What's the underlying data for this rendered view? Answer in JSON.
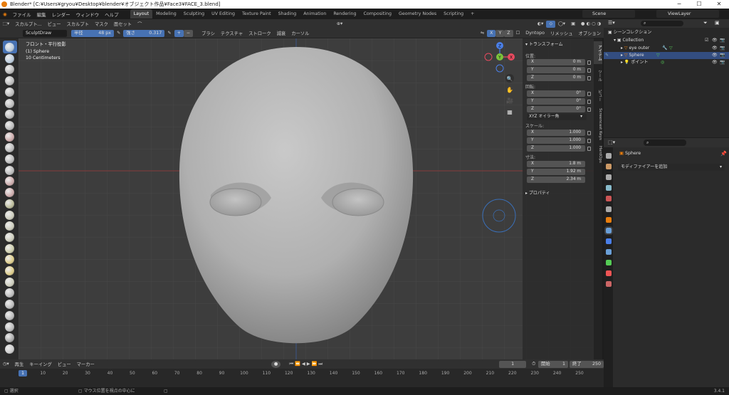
{
  "window": {
    "title": "Blender* [C:¥Users¥gryou¥Desktop¥blender¥オブジェクト作品¥Face3¥FACE_3.blend]",
    "controls": [
      "─",
      "☐",
      "✕"
    ]
  },
  "menus": [
    "ファイル",
    "編集",
    "レンダー",
    "ウィンドウ",
    "ヘルプ"
  ],
  "workspaces": [
    "Layout",
    "Modeling",
    "Sculpting",
    "UV Editing",
    "Texture Paint",
    "Shading",
    "Animation",
    "Rendering",
    "Compositing",
    "Geometry Nodes",
    "Scripting"
  ],
  "active_workspace": "Layout",
  "scene": {
    "name": "Scene",
    "view_layer": "ViewLayer"
  },
  "header1": {
    "mode": "スカルプト...",
    "items": [
      "ビュー",
      "スカルプト",
      "マスク",
      "面セット"
    ]
  },
  "header2": {
    "brush": "SculptDraw",
    "radius_label": "半径",
    "radius_value": "48 px",
    "strength_label": "強さ",
    "strength_value": "0.317",
    "menus": [
      "ブラシ",
      "テクスチャ",
      "ストローク",
      "減衰",
      "カーソル"
    ],
    "axes": [
      "X",
      "Y",
      "Z"
    ],
    "dyntopo": "Dyntopo",
    "remesh": "リメッシュ",
    "options": "オプション"
  },
  "viewport": {
    "view_name": "フロント・平行投影",
    "object_info": "(1) Sphere",
    "scale": "10 Centimeters",
    "gizmo": {
      "x": "X",
      "y": "Y",
      "z": "Z"
    },
    "colors": {
      "bg": "#3d3d3d",
      "grid": "#4a4a4a",
      "x_axis": "#9b3a3a",
      "z_axis": "#3a5c9b",
      "x_gizmo": "#e84a5f",
      "y_gizmo": "#7cc43b",
      "z_gizmo": "#4a7fe8"
    }
  },
  "tools": [
    "draw-brush",
    "draw-sharp-brush",
    "clay-brush",
    "clay-strips-brush",
    "clay-thumb-brush",
    "layer-brush",
    "inflate-brush",
    "blob-brush",
    "crease-brush",
    "smooth-brush",
    "flatten-brush",
    "fill-brush",
    "scrape-brush",
    "multiplane-scrape-brush",
    "pinch-brush",
    "grab-brush",
    "elastic-deform-brush",
    "snake-hook-brush",
    "thumb-brush",
    "pose-brush",
    "nudge-brush",
    "rotate-brush",
    "slide-relax-brush",
    "boundary-brush",
    "cloth-brush",
    "simplify-brush",
    "mask-brush",
    "draw-face-sets-brush"
  ],
  "npanel": {
    "transform_title": "トランスフォーム",
    "location_label": "位置:",
    "location": [
      {
        "axis": "X",
        "value": "0 m"
      },
      {
        "axis": "Y",
        "value": "0 m"
      },
      {
        "axis": "Z",
        "value": "0 m"
      }
    ],
    "rotation_label": "回転:",
    "rotation": [
      {
        "axis": "X",
        "value": "0°"
      },
      {
        "axis": "Y",
        "value": "0°"
      },
      {
        "axis": "Z",
        "value": "0°"
      }
    ],
    "rotation_mode": "XYZ オイラー角",
    "scale_label": "スケール:",
    "scale": [
      {
        "axis": "X",
        "value": "1.000"
      },
      {
        "axis": "Y",
        "value": "1.000"
      },
      {
        "axis": "Z",
        "value": "1.000"
      }
    ],
    "dimensions_label": "寸法:",
    "dimensions": [
      {
        "axis": "X",
        "value": "1.8 m"
      },
      {
        "axis": "Y",
        "value": "1.92 m"
      },
      {
        "axis": "Z",
        "value": "2.34 m"
      }
    ],
    "properties_title": "プロパティ",
    "tabs": [
      "アイテム",
      "ツール",
      "ビュー",
      "Screencast Keys",
      "HardOps"
    ]
  },
  "outliner": {
    "root": "シーンコレクション",
    "collection": "Collection",
    "objects": [
      "eye outer",
      "Sphere",
      "ポイント"
    ]
  },
  "properties": {
    "object": "Sphere",
    "add_modifier": "モディファイアーを追加"
  },
  "timeline": {
    "menus": [
      "再生",
      "キーイング",
      "ビュー",
      "マーカー"
    ],
    "current_frame": "1",
    "start_label": "開始",
    "start": "1",
    "end_label": "終了",
    "end": "250",
    "ticks": [
      "1",
      "10",
      "20",
      "30",
      "40",
      "50",
      "60",
      "70",
      "80",
      "90",
      "100",
      "110",
      "120",
      "130",
      "140",
      "150",
      "160",
      "170",
      "180",
      "190",
      "200",
      "210",
      "220",
      "230",
      "240",
      "250"
    ]
  },
  "status": {
    "select": "選択",
    "center": "マウス位置を視点の中心に",
    "version": "3.4.1"
  }
}
